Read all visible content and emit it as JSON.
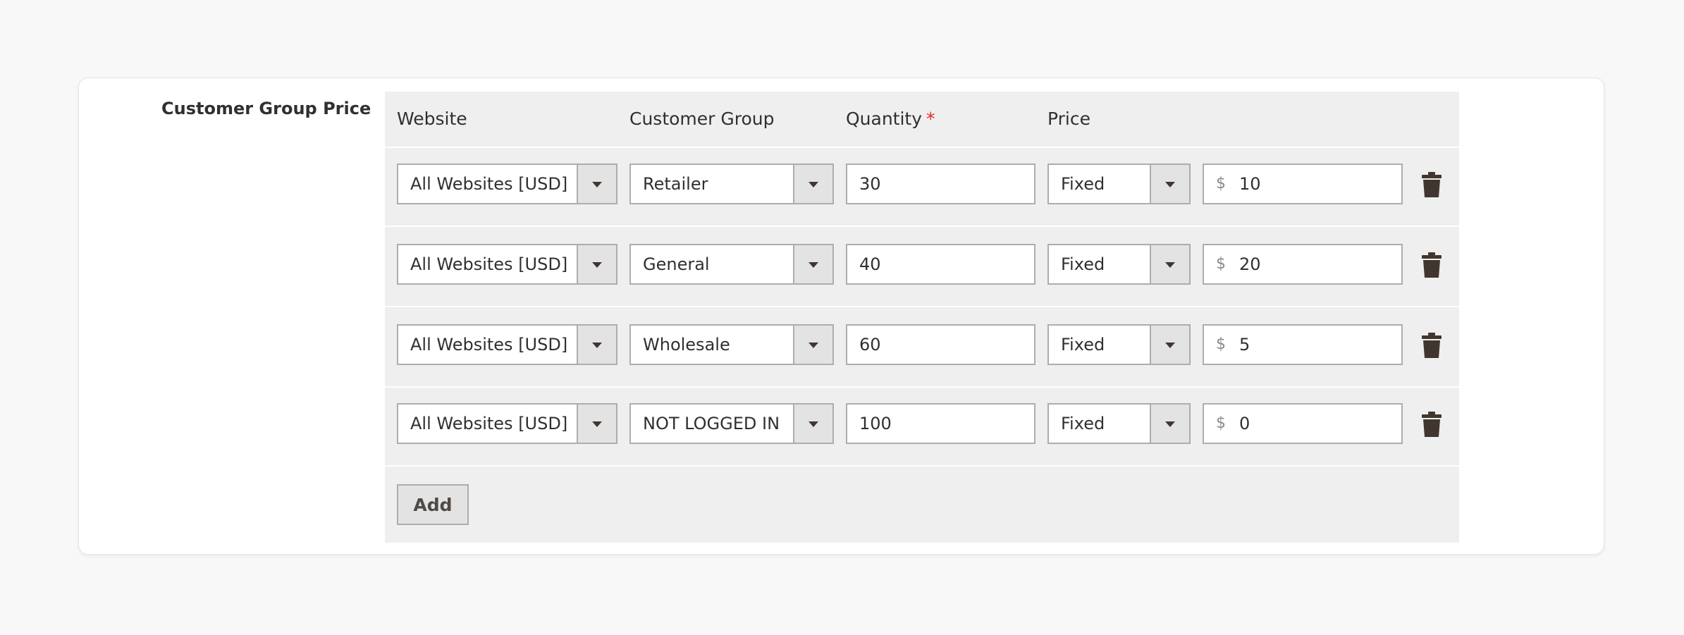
{
  "section": {
    "label": "Customer Group Price"
  },
  "table": {
    "headers": {
      "website": "Website",
      "customer_group": "Customer Group",
      "quantity": "Quantity",
      "quantity_required_mark": "*",
      "price": "Price"
    },
    "rows": [
      {
        "website": "All Websites [USD]",
        "customer_group": "Retailer",
        "quantity": "30",
        "price_type": "Fixed",
        "currency": "$",
        "price": "10"
      },
      {
        "website": "All Websites [USD]",
        "customer_group": "General",
        "quantity": "40",
        "price_type": "Fixed",
        "currency": "$",
        "price": "20"
      },
      {
        "website": "All Websites [USD]",
        "customer_group": "Wholesale",
        "quantity": "60",
        "price_type": "Fixed",
        "currency": "$",
        "price": "5"
      },
      {
        "website": "All Websites [USD]",
        "customer_group": "NOT LOGGED IN",
        "quantity": "100",
        "price_type": "Fixed",
        "currency": "$",
        "price": "0"
      }
    ],
    "add_label": "Add"
  },
  "icons": {
    "delete": "trash-icon",
    "dropdown": "chevron-down-icon"
  },
  "colors": {
    "page_bg": "#f8f8f8",
    "panel_bg": "#efefef",
    "required": "#e22626",
    "icon": "#41362f"
  }
}
